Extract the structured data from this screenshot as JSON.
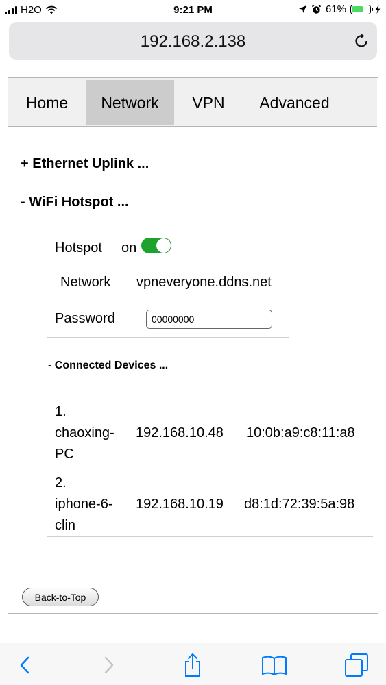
{
  "status_bar": {
    "carrier": "H2O",
    "time": "9:21 PM",
    "battery_percent": "61%",
    "battery_level": 0.61,
    "battery_color": "#4cd964"
  },
  "browser": {
    "url": "192.168.2.138",
    "reload_icon": "reload-icon"
  },
  "nav": {
    "tabs": [
      {
        "label": "Home",
        "active": false
      },
      {
        "label": "Network",
        "active": true
      },
      {
        "label": "VPN",
        "active": false
      },
      {
        "label": "Advanced",
        "active": false
      }
    ]
  },
  "sections": {
    "ethernet": "+ Ethernet Uplink ...",
    "wifi": "- WiFi Hotspot ..."
  },
  "hotspot": {
    "label": "Hotspot",
    "state_text": "on",
    "enabled": true,
    "toggle_color": "#1fa12e",
    "network_label": "Network",
    "network_value": "vpneveryone.ddns.net",
    "password_label": "Password",
    "password_value": "00000000"
  },
  "devices": {
    "title": "- Connected Devices ...",
    "rows": [
      {
        "name_lines": [
          "1.",
          "chaoxing-",
          "PC"
        ],
        "ip": "192.168.10.48",
        "mac": "10:0b:a9:c8:11:a8"
      },
      {
        "name_lines": [
          "2.",
          "iphone-6-",
          "clin"
        ],
        "ip": "192.168.10.19",
        "mac": "d8:1d:72:39:5a:98"
      }
    ]
  },
  "back_to_top": "Back-to-Top",
  "toolbar": {
    "icons": [
      "back-icon",
      "forward-icon",
      "share-icon",
      "bookmarks-icon",
      "tabs-icon"
    ],
    "accent": "#007aff"
  }
}
